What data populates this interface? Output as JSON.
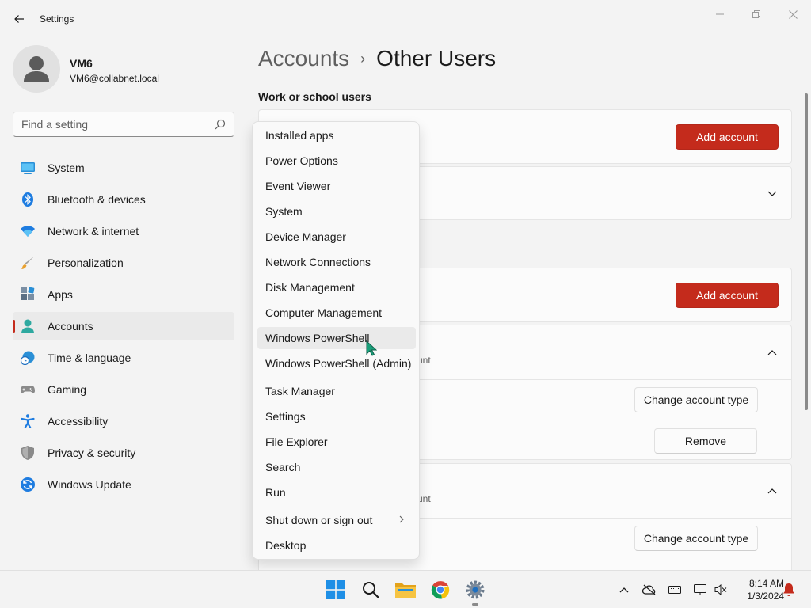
{
  "window": {
    "title": "Settings"
  },
  "profile": {
    "name": "VM6",
    "email": "VM6@collabnet.local"
  },
  "search": {
    "placeholder": "Find a setting"
  },
  "sidebar": {
    "items": [
      {
        "label": "System",
        "icon": "monitor-icon"
      },
      {
        "label": "Bluetooth & devices",
        "icon": "bluetooth-icon"
      },
      {
        "label": "Network & internet",
        "icon": "wifi-icon"
      },
      {
        "label": "Personalization",
        "icon": "brush-icon"
      },
      {
        "label": "Apps",
        "icon": "apps-icon"
      },
      {
        "label": "Accounts",
        "icon": "person-icon",
        "selected": true
      },
      {
        "label": "Time & language",
        "icon": "globe-clock-icon"
      },
      {
        "label": "Gaming",
        "icon": "gamepad-icon"
      },
      {
        "label": "Accessibility",
        "icon": "accessibility-icon"
      },
      {
        "label": "Privacy & security",
        "icon": "shield-icon"
      },
      {
        "label": "Windows Update",
        "icon": "update-icon"
      }
    ]
  },
  "breadcrumb": {
    "parent": "Accounts",
    "separator": "›",
    "current": "Other Users"
  },
  "main": {
    "work_section_title": "Work or school users",
    "add_account_label": "Add account",
    "add_account_label_2": "Add account",
    "account_1_type_suffix": "unt",
    "account_2_type_suffix": "unt",
    "change_type_label": "Change account type",
    "remove_label": "Remove",
    "change_type_label_2": "Change account type"
  },
  "context_menu": {
    "items": [
      "Installed apps",
      "Power Options",
      "Event Viewer",
      "System",
      "Device Manager",
      "Network Connections",
      "Disk Management",
      "Computer Management",
      "Windows PowerShell",
      "Windows PowerShell (Admin)",
      "Task Manager",
      "Settings",
      "File Explorer",
      "Search",
      "Run",
      "Shut down or sign out",
      "Desktop"
    ],
    "hovered": "Windows PowerShell"
  },
  "taskbar": {
    "apps": [
      "start-icon",
      "search-icon",
      "file-explorer-icon",
      "chrome-icon",
      "settings-icon"
    ],
    "clock_time": "8:14 AM",
    "clock_date": "1/3/2024"
  },
  "colors": {
    "accent": "#c42b1c",
    "background": "#f3f3f3",
    "card": "#fbfbfb"
  }
}
